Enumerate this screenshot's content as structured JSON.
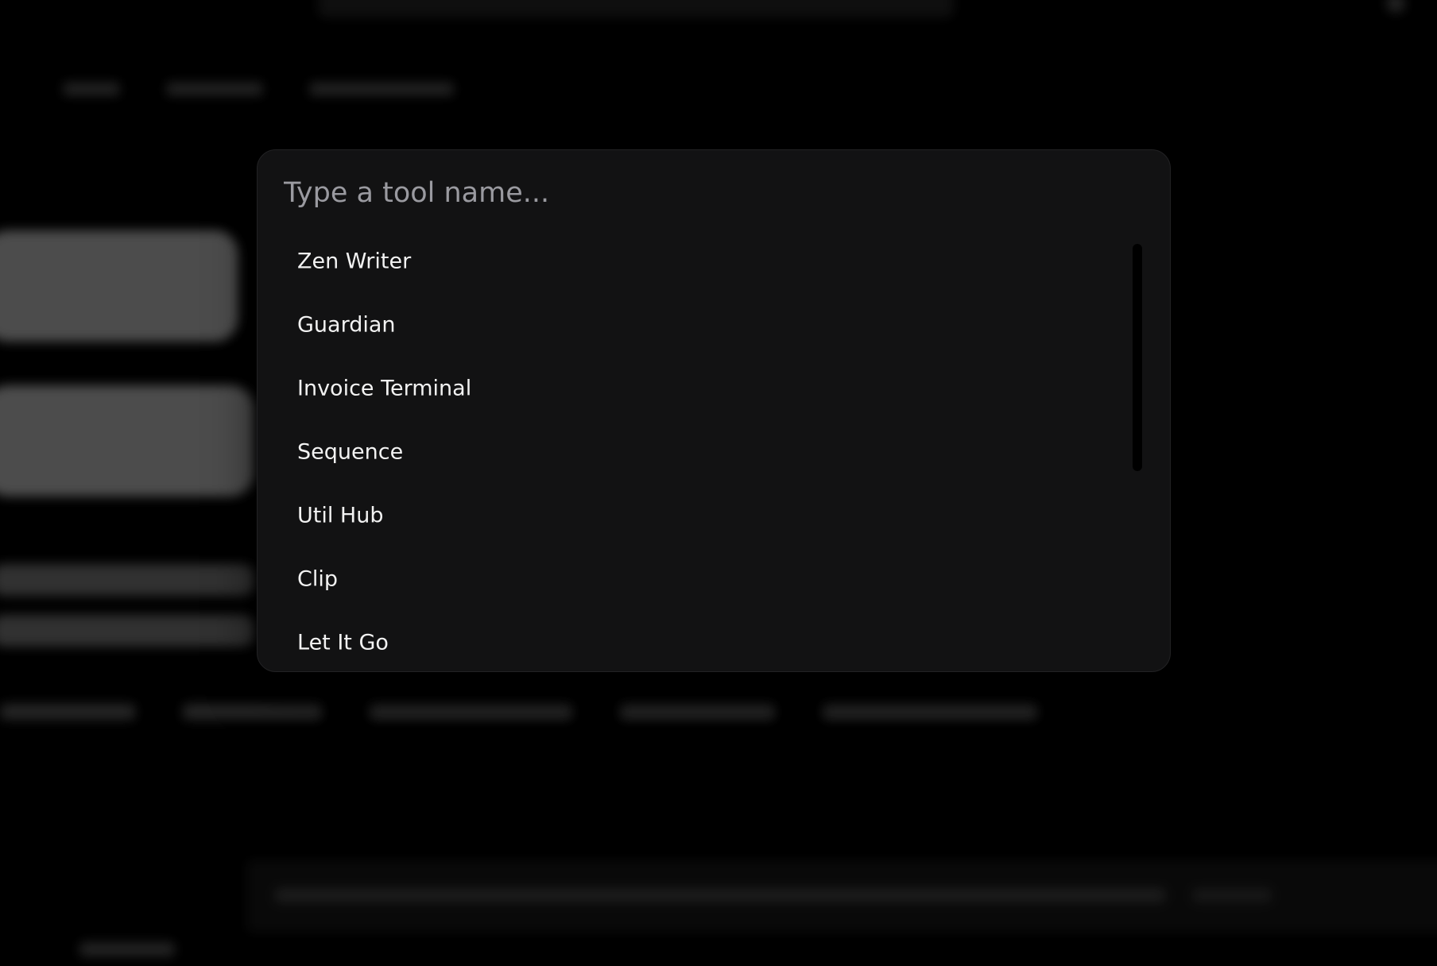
{
  "search": {
    "placeholder": "Type a tool name..."
  },
  "tools": [
    "Zen Writer",
    "Guardian",
    "Invoice Terminal",
    "Sequence",
    "Util Hub",
    "Clip",
    "Let It Go"
  ],
  "colors": {
    "page_background": "#000000",
    "palette_background": "#121213",
    "item_text": "#f2f2f2",
    "placeholder_text": "#9a9aa0"
  }
}
